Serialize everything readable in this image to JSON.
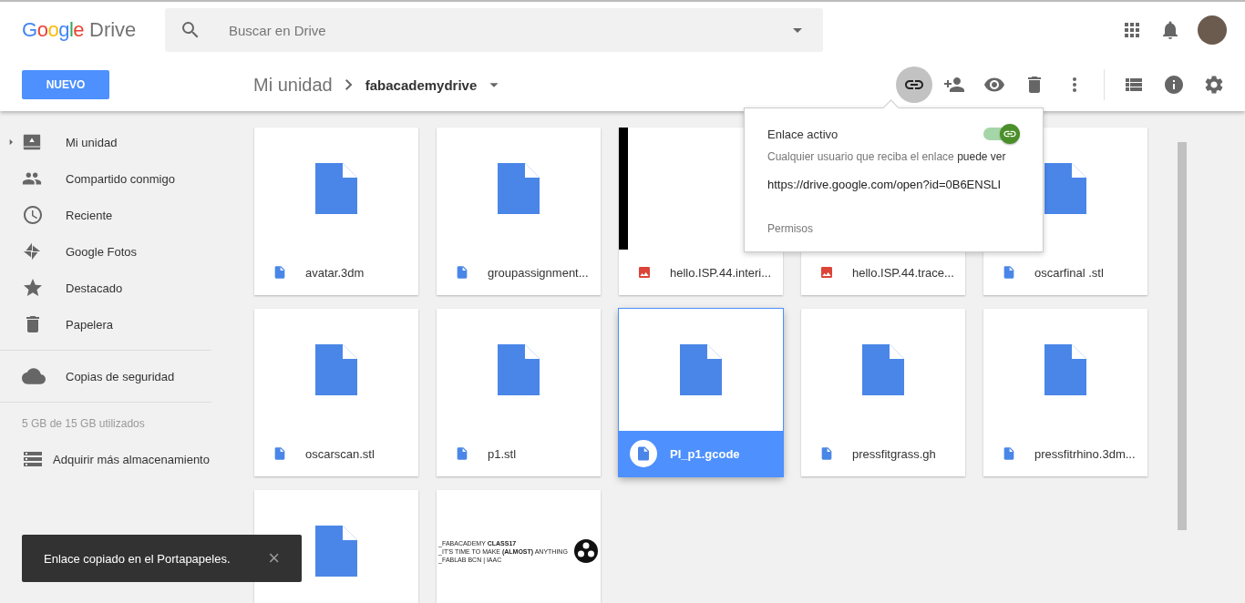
{
  "header": {
    "logo": {
      "brand": "Google",
      "product": "Drive"
    },
    "search": {
      "placeholder": "Buscar en Drive"
    },
    "actions": [
      {
        "kind": "apps"
      },
      {
        "kind": "notifications"
      },
      {
        "kind": "avatar"
      }
    ]
  },
  "toolbar": {
    "new_button": "NUEVO",
    "breadcrumb": [
      {
        "label": "Mi unidad",
        "current": false
      },
      {
        "label": "fabacademydrive",
        "current": true
      }
    ],
    "buttons": [
      {
        "kind": "link",
        "selected": true
      },
      {
        "kind": "share",
        "selected": false
      },
      {
        "kind": "preview",
        "selected": false
      },
      {
        "kind": "delete",
        "selected": false
      },
      {
        "kind": "more",
        "selected": false
      }
    ],
    "view_buttons": [
      {
        "kind": "list",
        "selected": false
      },
      {
        "kind": "info",
        "selected": false
      },
      {
        "kind": "settings",
        "selected": false
      }
    ]
  },
  "sidebar": {
    "items": [
      {
        "kind": "drive",
        "label": "Mi unidad",
        "expandable": true
      },
      {
        "kind": "shared",
        "label": "Compartido conmigo",
        "expandable": false
      },
      {
        "kind": "recent",
        "label": "Reciente",
        "expandable": false
      },
      {
        "kind": "photos",
        "label": "Google Fotos",
        "expandable": false
      },
      {
        "kind": "starred",
        "label": "Destacado",
        "expandable": false
      },
      {
        "kind": "trash",
        "label": "Papelera",
        "expandable": false
      },
      {
        "kind": "backup",
        "label": "Copias de seguridad",
        "expandable": false
      }
    ],
    "storage": "5 GB de 15 GB utilizados",
    "upgrade": "Adquirir más almacenamiento"
  },
  "files": [
    {
      "name": "avatar.3dm",
      "kind": "doc",
      "selected": false
    },
    {
      "name": "groupassignment...",
      "kind": "doc",
      "selected": false
    },
    {
      "name": "hello.ISP.44.interi...",
      "kind": "image",
      "selected": false
    },
    {
      "name": "hello.ISP.44.trace...",
      "kind": "covered_image",
      "selected": false
    },
    {
      "name": "oscarfinal .stl",
      "kind": "doc",
      "selected": false
    },
    {
      "name": "oscarscan.stl",
      "kind": "doc",
      "selected": false
    },
    {
      "name": "p1.stl",
      "kind": "doc",
      "selected": false
    },
    {
      "name": "PI_p1.gcode",
      "kind": "doc",
      "selected": true
    },
    {
      "name": "pressfitgrass.gh",
      "kind": "doc",
      "selected": false
    },
    {
      "name": "pressfitrhino.3dm...",
      "kind": "doc",
      "selected": false
    },
    {
      "kind": "doc",
      "selected": false
    },
    {
      "kind": "logo",
      "selected": false,
      "logo_lines": [
        "_FABACADEMY  **CLASS17**",
        "_IT'S TIME TO MAKE **(ALMOST)** ANYTHING",
        "_FABLAB BCN | IAAC"
      ]
    }
  ],
  "link_popup": {
    "title": "Enlace activo",
    "link_on": true,
    "description": "Cualquier usuario que reciba el enlace",
    "access": "puede ver",
    "url": "https://drive.google.com/open?id=0B6ENSLI",
    "permissions": "Permisos"
  },
  "toast": {
    "message": "Enlace copiado en el Portapapeles.",
    "close": "×"
  }
}
